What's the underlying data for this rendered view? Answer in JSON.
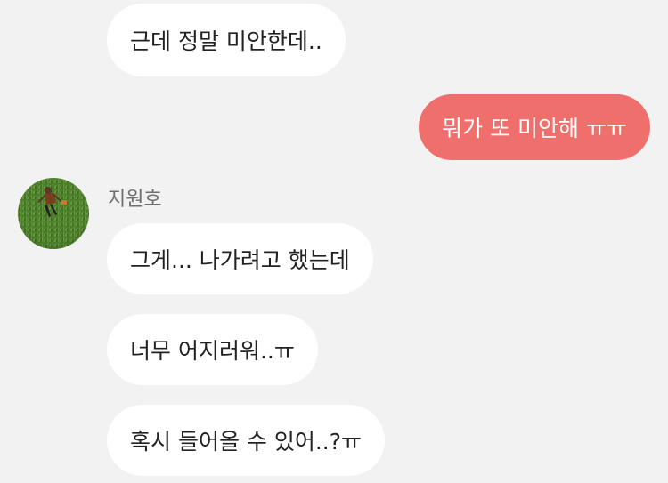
{
  "chat": {
    "messages": [
      {
        "id": 1,
        "direction": "incoming",
        "text": "근데 정말 미안한데.."
      },
      {
        "id": 2,
        "direction": "outgoing",
        "text": "뭐가 또 미안해 ㅠㅠ"
      },
      {
        "id": 3,
        "direction": "incoming",
        "text": "그게... 나가려고 했는데"
      },
      {
        "id": 4,
        "direction": "incoming",
        "text": "너무 어지러워..ㅠ"
      },
      {
        "id": 5,
        "direction": "incoming",
        "text": "혹시 들어올 수 있어..?ㅠ"
      }
    ],
    "sender": {
      "name": "지원호",
      "avatar_icon": "person-lying-on-grass-photo"
    }
  },
  "colors": {
    "background": "#f2f2f2",
    "incoming_bubble": "#ffffff",
    "outgoing_bubble": "#ef6f6c",
    "incoming_text": "#222222",
    "outgoing_text": "#ffffff",
    "sender_name": "#6f6f6f",
    "grass": "#4a7d2a"
  }
}
